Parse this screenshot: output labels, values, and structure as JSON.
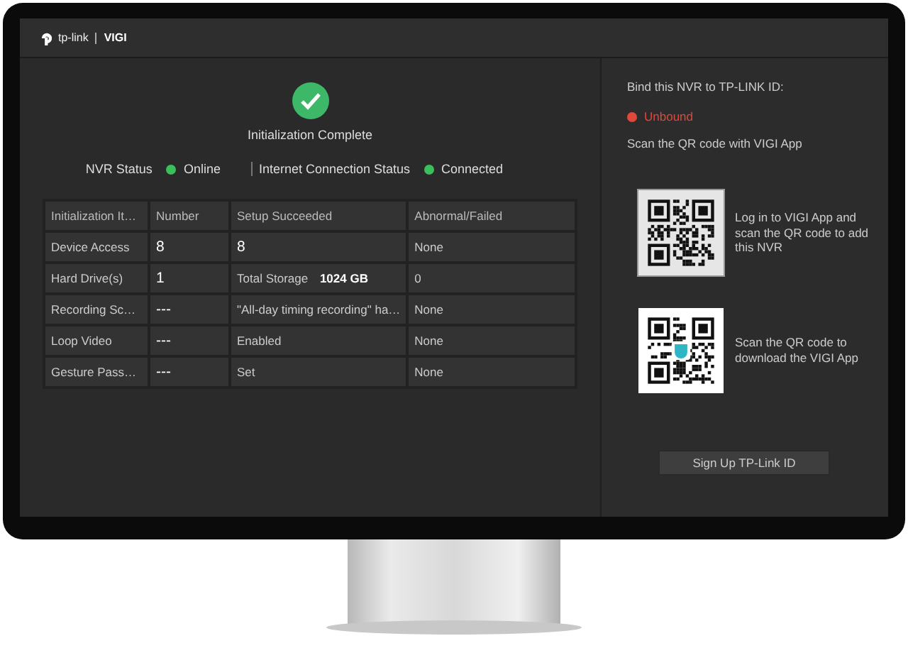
{
  "header": {
    "logo_text": "tp-link",
    "product": "VIGI"
  },
  "status": {
    "title": "Initialization Complete",
    "items": [
      {
        "label": "NVR Status",
        "value": "Online",
        "color": "#3bbf5a"
      },
      {
        "label": "Internet Connection Status",
        "value": "Connected",
        "color": "#3bbf5a"
      }
    ]
  },
  "table": {
    "columns": [
      "Initialization It…",
      "Number",
      "Setup Succeeded",
      "Abnormal/Failed"
    ],
    "rows": [
      [
        "Device Access",
        "8",
        "8",
        "None"
      ],
      [
        "Hard Drive(s)",
        "1",
        "Total Storage  **1024 GB**",
        "0"
      ],
      [
        "Recording Sc…",
        "---",
        "\"All-day timing recording\" ha…",
        "None"
      ],
      [
        "Loop Video",
        "---",
        "Enabled",
        "None"
      ],
      [
        "Gesture Pass…",
        "---",
        "Set",
        "None"
      ]
    ]
  },
  "bind": {
    "title": "Bind this NVR to TP-LINK ID:",
    "state": "Unbound",
    "color": "#e0483a",
    "hint": "Scan the QR code with VIGI App",
    "qr_codes": [
      {
        "text": "Log in to VIGI App and scan the QR code to add  this NVR",
        "badge": false
      },
      {
        "text": "Scan the QR code to download the VIGI App",
        "badge": true
      }
    ],
    "button": "Sign Up TP-Link ID"
  }
}
